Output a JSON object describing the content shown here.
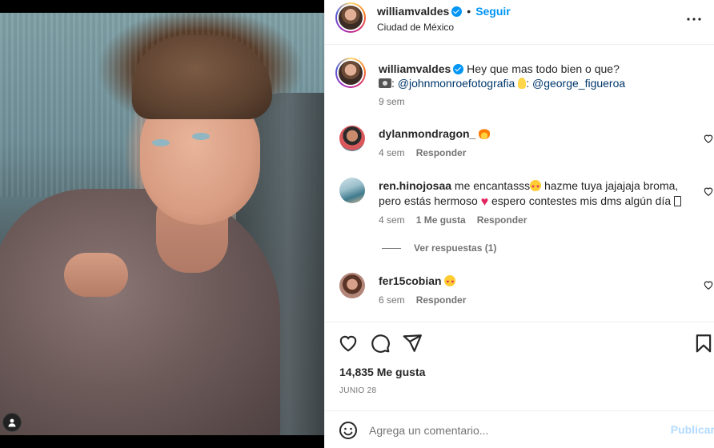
{
  "post": {
    "author": "williamvaldes",
    "follow_label": "Seguir",
    "location": "Ciudad de México",
    "separator": "•"
  },
  "caption": {
    "author": "williamvaldes",
    "text_line1": "Hey que mas todo bien o que?",
    "sep1": ":",
    "photographer": "@johnmonroefotografia",
    "sep2": ":",
    "stylist": "@george_figueroa",
    "time": "9 sem"
  },
  "comments": [
    {
      "user": "dylanmondragon_",
      "text": "",
      "emoji": "fire-emoji",
      "time": "4 sem",
      "reply_label": "Responder"
    },
    {
      "user": "ren.hinojosaa",
      "text_a": "me encantasss",
      "text_b": "hazme tuya jajajaja broma, pero estás hermoso",
      "text_c": "espero contestes mis dms algún día",
      "time": "4 sem",
      "likes_label": "1 Me gusta",
      "reply_label": "Responder",
      "view_replies": "Ver respuestas (1)"
    },
    {
      "user": "fer15cobian",
      "text": "",
      "emoji": "heart-eyes-emoji",
      "time": "6 sem",
      "reply_label": "Responder"
    }
  ],
  "actions": {
    "like_icon": "heart-icon",
    "comment_icon": "comment-icon",
    "share_icon": "share-icon",
    "save_icon": "bookmark-icon"
  },
  "likes_text": "14,835 Me gusta",
  "date": "JUNIO 28",
  "comment_box": {
    "placeholder": "Agrega un comentario...",
    "post_label": "Publicar"
  },
  "colors": {
    "accent": "#0095f6",
    "muted": "#737373",
    "mention": "#00376b",
    "post_disabled": "#b3dbff"
  }
}
